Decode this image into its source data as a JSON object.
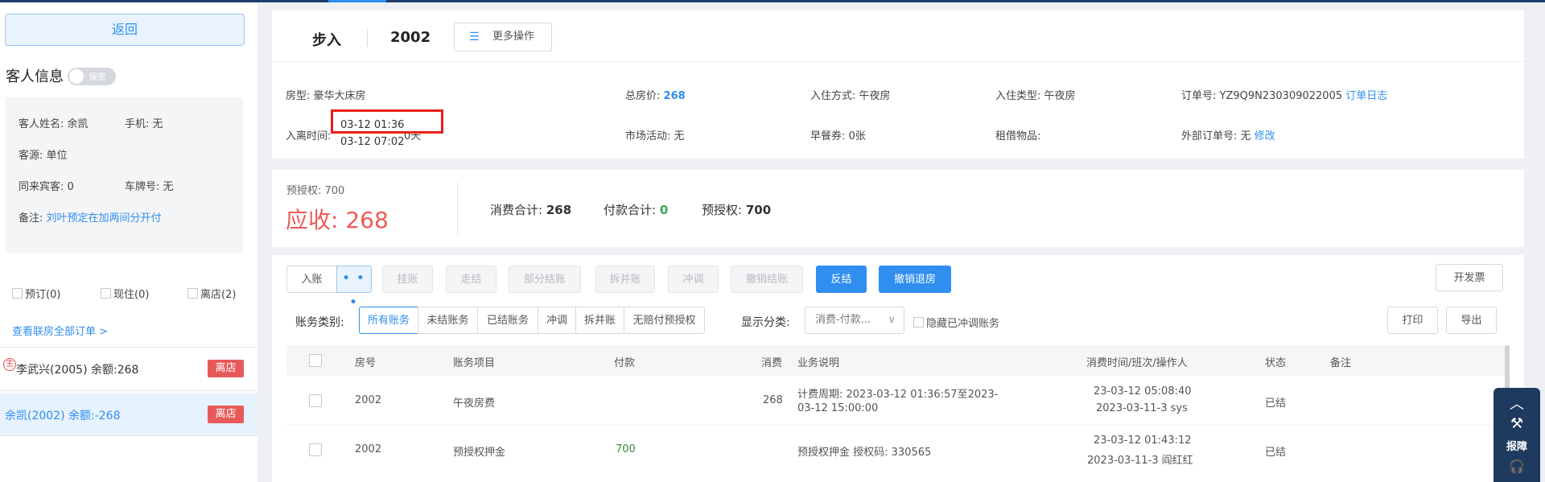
{
  "sidebar": {
    "back_label": "返回",
    "guest_info_title": "客人信息",
    "privacy_label": "保密",
    "guest": {
      "name": "客人姓名: 余凯",
      "phone": "手机: 无",
      "source": "客源: 单位",
      "companions": "同来宾客: 0",
      "plate": "车牌号: 无",
      "remark_label": "备注:",
      "remark_value": "刘叶预定在加两间分开付"
    },
    "status_filters": [
      "预订(0)",
      "现住(0)",
      "离店(2)"
    ],
    "view_all_orders": "查看联房全部订单 >",
    "orders": [
      {
        "main_mark": "主",
        "text": "李武兴(2005)   余额:268",
        "badge": "离店"
      },
      {
        "text": "余凯(2002)   余额:-268",
        "badge": "离店"
      }
    ]
  },
  "header": {
    "room_type": "步入",
    "room_no": "2002",
    "more_actions": "更多操作",
    "more_icon": "list-icon"
  },
  "details": {
    "room_type": "房型: 豪华大床房",
    "total_price_label": "总房价:",
    "total_price_value": "268",
    "checkin_method": "入住方式: 午夜房",
    "checkin_type": "入住类型: 午夜房",
    "order_no": "订单号: YZ9Q9N230309022005",
    "order_log": "订单日志",
    "stay_time_label": "入离时间:",
    "arrive_time": "03-12 01:36",
    "leave_time": "03-12 07:02",
    "days": "0天",
    "market": "市场活动: 无",
    "breakfast": "早餐券: 0张",
    "rental": "租借物品:",
    "external_order_label": "外部订单号: 无",
    "modify": "修改"
  },
  "summary": {
    "prepay_small": "预授权: 700",
    "receivable_label": "应收:",
    "receivable_value": "268",
    "consume_label": "消费合计:",
    "consume_value": "268",
    "payment_label": "付款合计:",
    "payment_value": "0",
    "preauth_label": "预授权:",
    "preauth_value": "700"
  },
  "toolbar": {
    "post": "入账",
    "dots": "• • •",
    "hang": "挂账",
    "walk": "走结",
    "partial": "部分结账",
    "split": "拆并账",
    "offset": "冲调",
    "cancel_settle": "撤销结账",
    "reverse": "反结",
    "cancel_checkout": "撤销退房",
    "invoice": "开发票",
    "print": "打印",
    "export": "导出"
  },
  "filters": {
    "category_label": "账务类别:",
    "categories": [
      "所有账务",
      "未结账务",
      "已结账务",
      "冲调",
      "拆并账",
      "无赔付预授权"
    ],
    "display_label": "显示分类:",
    "display_value": "消费-付款...",
    "hide_offset": "隐藏已冲调账务"
  },
  "table": {
    "columns": [
      "房号",
      "账务项目",
      "付款",
      "消费",
      "业务说明",
      "消费时间/班次/操作人",
      "状态",
      "备注"
    ],
    "rows": [
      {
        "room": "2002",
        "item": "午夜房费",
        "payment": "",
        "consume": "268",
        "desc1": "计费周期: 2023-03-12 01:36:57至2023-",
        "desc2": "03-12 15:00:00",
        "time1": "23-03-12 05:08:40",
        "time2": "2023-03-11-3 sys",
        "status": "已结",
        "remark": ""
      },
      {
        "room": "2002",
        "item": "预授权押金",
        "payment": "700",
        "consume": "",
        "desc1": "预授权押金 授权码: 330565",
        "desc2": "",
        "time1": "23-03-12 01:43:12",
        "time2": "2023-03-11-3 阎红红",
        "status": "已结",
        "remark": ""
      }
    ]
  },
  "float": {
    "report": "报障",
    "up_icon": "chevron-up-icon",
    "wrench_icon": "wrench-icon",
    "headset_icon": "headset-icon"
  },
  "colors": {
    "accent": "#2f8ef0",
    "danger": "#e85a5a",
    "receivable": "#ec5b56",
    "highlight_box": "#e8201a"
  }
}
